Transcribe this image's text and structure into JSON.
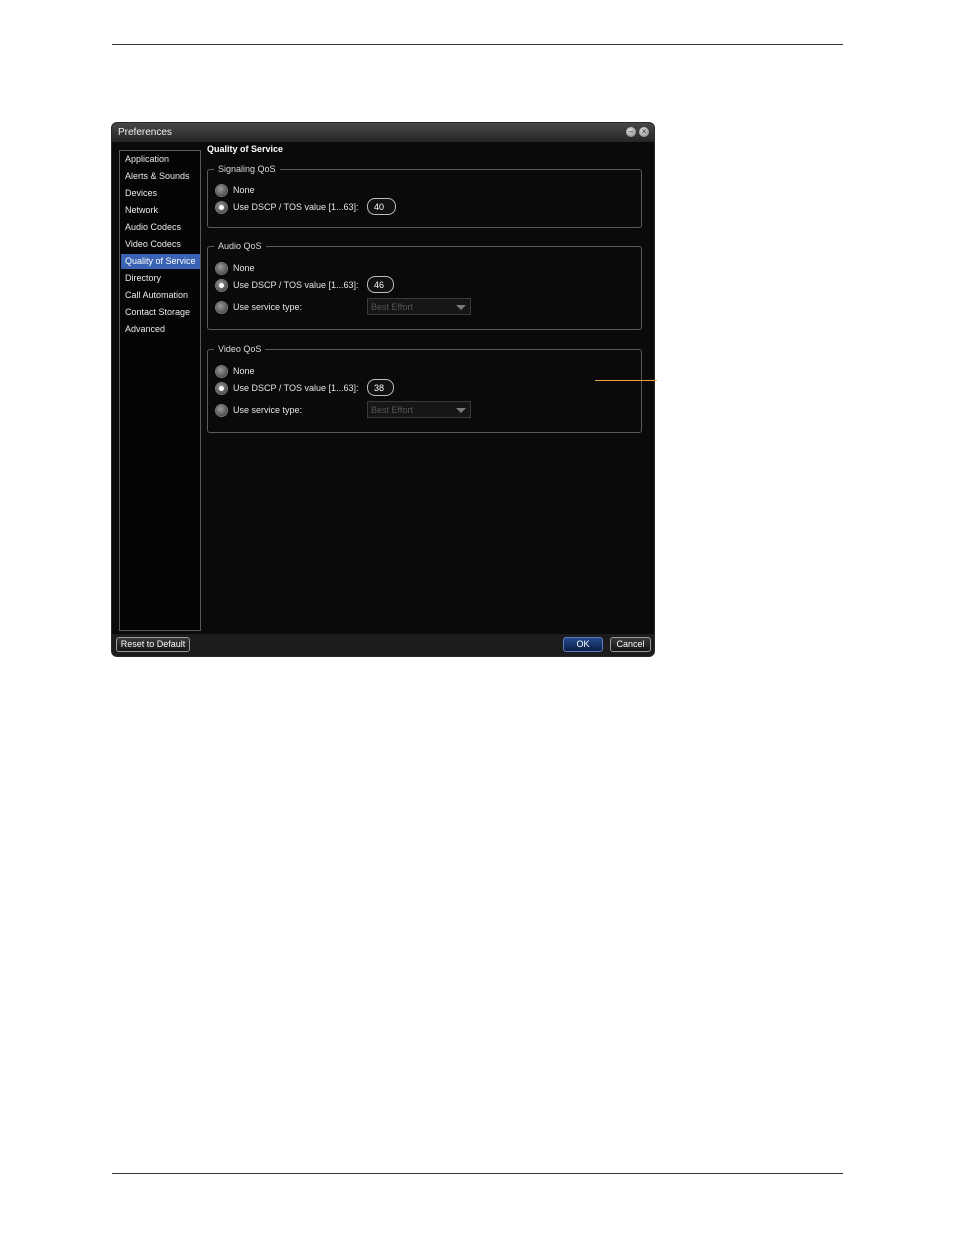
{
  "window": {
    "title": "Preferences"
  },
  "sidebar": {
    "items": [
      {
        "label": "Application",
        "selected": false
      },
      {
        "label": "Alerts & Sounds",
        "selected": false
      },
      {
        "label": "Devices",
        "selected": false
      },
      {
        "label": "Network",
        "selected": false
      },
      {
        "label": "Audio Codecs",
        "selected": false
      },
      {
        "label": "Video Codecs",
        "selected": false
      },
      {
        "label": "Quality of Service",
        "selected": true
      },
      {
        "label": "Directory",
        "selected": false
      },
      {
        "label": "Call Automation",
        "selected": false
      },
      {
        "label": "Contact Storage",
        "selected": false
      },
      {
        "label": "Advanced",
        "selected": false
      }
    ]
  },
  "panel": {
    "heading": "Quality of Service",
    "signaling": {
      "legend": "Signaling QoS",
      "none_label": "None",
      "dscp_label": "Use DSCP / TOS value [1...63]:",
      "dscp_value": "40",
      "selected": "dscp"
    },
    "audio": {
      "legend": "Audio QoS",
      "none_label": "None",
      "dscp_label": "Use DSCP / TOS value [1...63]:",
      "dscp_value": "46",
      "service_label": "Use service type:",
      "service_value": "Best Effort",
      "selected": "dscp"
    },
    "video": {
      "legend": "Video QoS",
      "none_label": "None",
      "dscp_label": "Use DSCP / TOS value [1...63]:",
      "dscp_value": "38",
      "service_label": "Use service type:",
      "service_value": "Best Effort",
      "selected": "dscp"
    }
  },
  "footer": {
    "reset_label": "Reset to Default",
    "ok_label": "OK",
    "cancel_label": "Cancel"
  },
  "colors": {
    "selection": "#3a63b5",
    "callout": "#e8a33c"
  }
}
